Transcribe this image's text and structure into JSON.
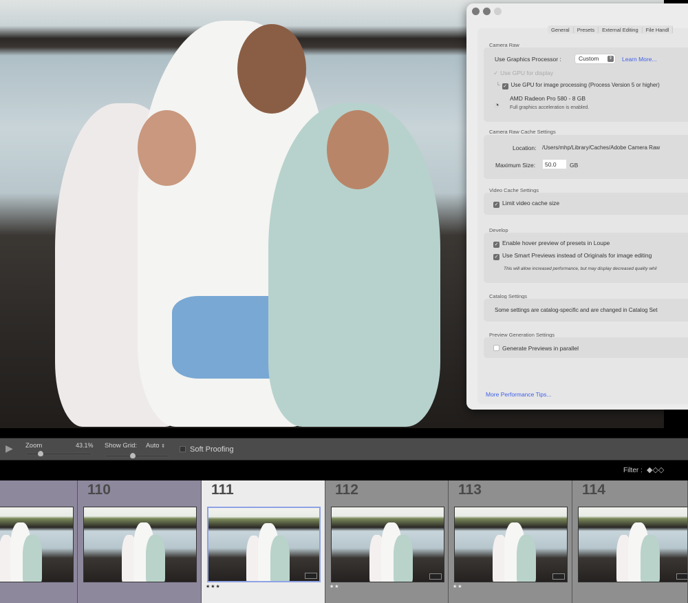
{
  "dialog": {
    "tabs": [
      "General",
      "Presets",
      "External Editing",
      "File Handl"
    ],
    "camera_raw": {
      "title": "Camera Raw",
      "gp_label": "Use Graphics Processor :",
      "gp_value": "Custom",
      "learn_more": "Learn More...",
      "gpu_display": "Use GPU for display",
      "gpu_processing": "Use GPU for image processing (Process Version 5 or higher)",
      "gpu_name": "AMD Radeon Pro 580 - 8 GB",
      "gpu_status": "Full graphics acceleration is enabled."
    },
    "cache": {
      "title": "Camera Raw Cache Settings",
      "location_label": "Location:",
      "location_value": "/Users/mhp/Library/Caches/Adobe Camera Raw",
      "max_label": "Maximum Size:",
      "max_value": "50.0",
      "max_unit": "GB"
    },
    "video": {
      "title": "Video Cache Settings",
      "limit": "Limit video cache size"
    },
    "develop": {
      "title": "Develop",
      "hover": "Enable hover preview of presets in Loupe",
      "smart": "Use Smart Previews instead of Originals for image editing",
      "note": "This will allow increased performance, but may display decreased quality whil"
    },
    "catalog": {
      "title": "Catalog Settings",
      "text": "Some settings are catalog-specific and are changed in Catalog Set"
    },
    "preview": {
      "title": "Preview Generation Settings",
      "parallel": "Generate Previews in parallel"
    },
    "tips": "More Performance Tips..."
  },
  "toolbar": {
    "zoom_label": "Zoom",
    "zoom_value": "43.1%",
    "grid_label": "Show Grid:",
    "grid_value": "Auto",
    "soft_proofing": "Soft Proofing"
  },
  "filter": {
    "label": "Filter :"
  },
  "filmstrip": [
    {
      "num": "",
      "stars": "",
      "bg": "#8e889d"
    },
    {
      "num": "110",
      "stars": "",
      "bg": "#8e889d"
    },
    {
      "num": "111",
      "stars": "★★★",
      "bg": "#ececec",
      "selected": true
    },
    {
      "num": "112",
      "stars": "★★",
      "bg": "#8f8f8f"
    },
    {
      "num": "113",
      "stars": "★★",
      "bg": "#8f8f8f"
    },
    {
      "num": "114",
      "stars": "",
      "bg": "#8f8f8f"
    }
  ]
}
